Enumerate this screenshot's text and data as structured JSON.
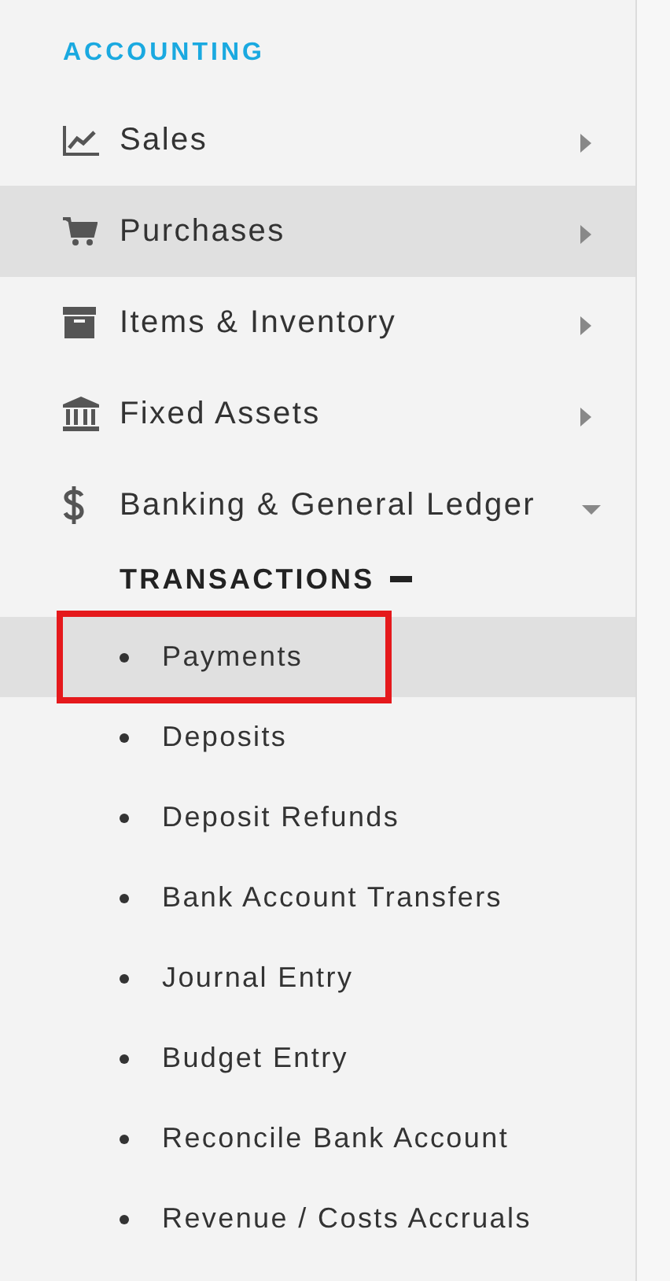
{
  "sidebar": {
    "section_title": "ACCOUNTING",
    "items": [
      {
        "label": "Sales",
        "highlighted": false,
        "expanded": false
      },
      {
        "label": "Purchases",
        "highlighted": true,
        "expanded": false
      },
      {
        "label": "Items & Inventory",
        "highlighted": false,
        "expanded": false
      },
      {
        "label": "Fixed Assets",
        "highlighted": false,
        "expanded": false
      },
      {
        "label": "Banking & General Ledger",
        "highlighted": false,
        "expanded": true,
        "group": {
          "title": "TRANSACTIONS",
          "expanded": true,
          "children": [
            {
              "label": "Payments",
              "highlighted": true,
              "annotated": true
            },
            {
              "label": "Deposits",
              "highlighted": false,
              "annotated": false
            },
            {
              "label": "Deposit Refunds",
              "highlighted": false,
              "annotated": false
            },
            {
              "label": "Bank Account Transfers",
              "highlighted": false,
              "annotated": false
            },
            {
              "label": "Journal Entry",
              "highlighted": false,
              "annotated": false
            },
            {
              "label": "Budget Entry",
              "highlighted": false,
              "annotated": false
            },
            {
              "label": "Reconcile Bank Account",
              "highlighted": false,
              "annotated": false
            },
            {
              "label": "Revenue / Costs Accruals",
              "highlighted": false,
              "annotated": false
            }
          ]
        }
      }
    ]
  }
}
